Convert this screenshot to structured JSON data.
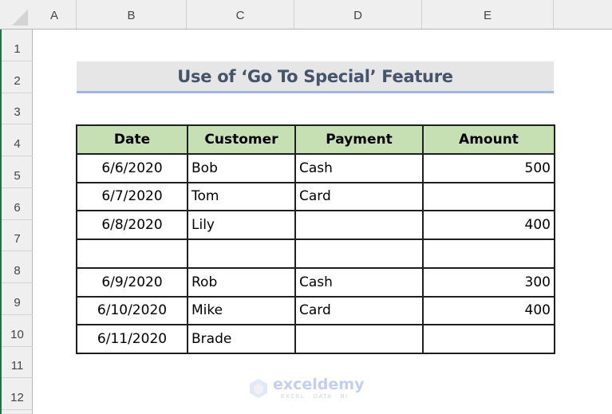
{
  "sheet": {
    "columns": [
      "A",
      "B",
      "C",
      "D",
      "E"
    ],
    "rows": [
      "1",
      "2",
      "3",
      "4",
      "5",
      "6",
      "7",
      "8",
      "9",
      "10",
      "11",
      "12"
    ],
    "gridlines": false,
    "accent_color": "#217346"
  },
  "title": {
    "text": "Use of ‘Go To Special’ Feature",
    "background": "#e7e6e6",
    "text_color": "#44546a",
    "underline_color": "#9fb6de"
  },
  "table": {
    "header_background": "#c6e0b4",
    "headers": [
      "Date",
      "Customer",
      "Payment",
      "Amount"
    ],
    "rows": [
      [
        "6/6/2020",
        "Bob",
        "Cash",
        "500"
      ],
      [
        "6/7/2020",
        "Tom",
        "Card",
        ""
      ],
      [
        "6/8/2020",
        "Lily",
        "",
        "400"
      ],
      [
        "",
        "",
        "",
        ""
      ],
      [
        "6/9/2020",
        "Rob",
        "Cash",
        "300"
      ],
      [
        "6/10/2020",
        "Mike",
        "Card",
        "400"
      ],
      [
        "6/11/2020",
        "Brade",
        "",
        ""
      ]
    ]
  },
  "watermark": {
    "name": "exceldemy",
    "tagline": "EXCEL · DATA · BI"
  }
}
